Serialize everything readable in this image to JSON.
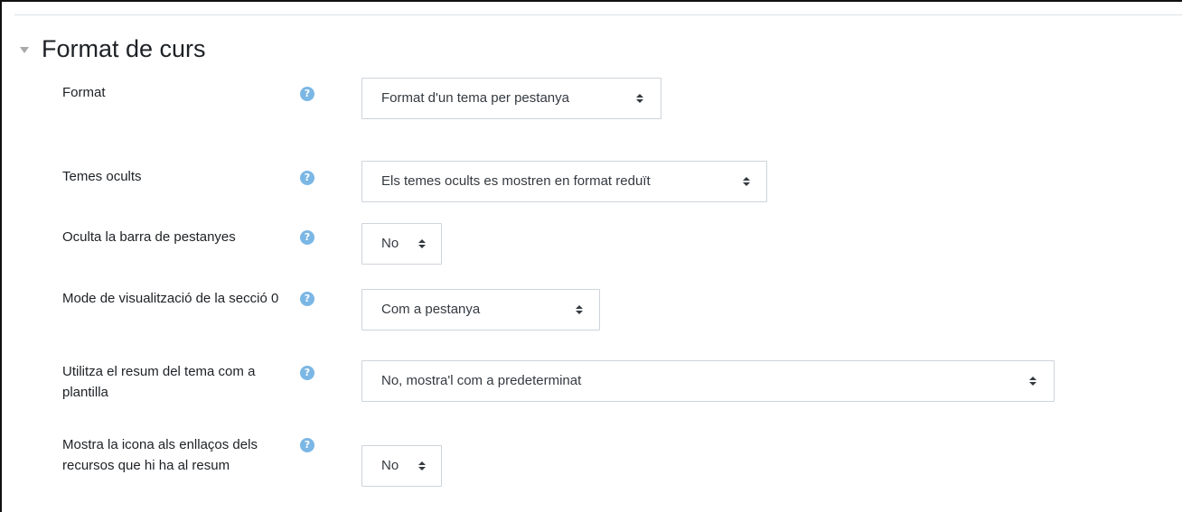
{
  "section": {
    "title": "Format de curs"
  },
  "fields": [
    {
      "label": "Format",
      "help": "?",
      "value": "Format d'un tema per pestanya"
    },
    {
      "label": "Temes ocults",
      "help": "?",
      "value": "Els temes ocults es mostren en format reduït"
    },
    {
      "label": "Oculta la barra de pestanyes",
      "help": "?",
      "value": "No"
    },
    {
      "label": "Mode de visualització de la secció 0",
      "help": "?",
      "value": "Com a pestanya"
    },
    {
      "label": "Utilitza el resum del tema com a plantilla",
      "help": "?",
      "value": "No, mostra'l com a predeterminat"
    },
    {
      "label": "Mostra la icona als enllaços dels recursos que hi ha al resum",
      "help": "?",
      "value": "No"
    }
  ],
  "colors": {
    "help_icon": "#7bb7e5",
    "text": "#1d2125",
    "border": "#ced4da"
  },
  "icons": {
    "collapse": "chevron-down-icon",
    "help": "question-circle-icon",
    "select_caret": "sort-arrows-icon"
  }
}
